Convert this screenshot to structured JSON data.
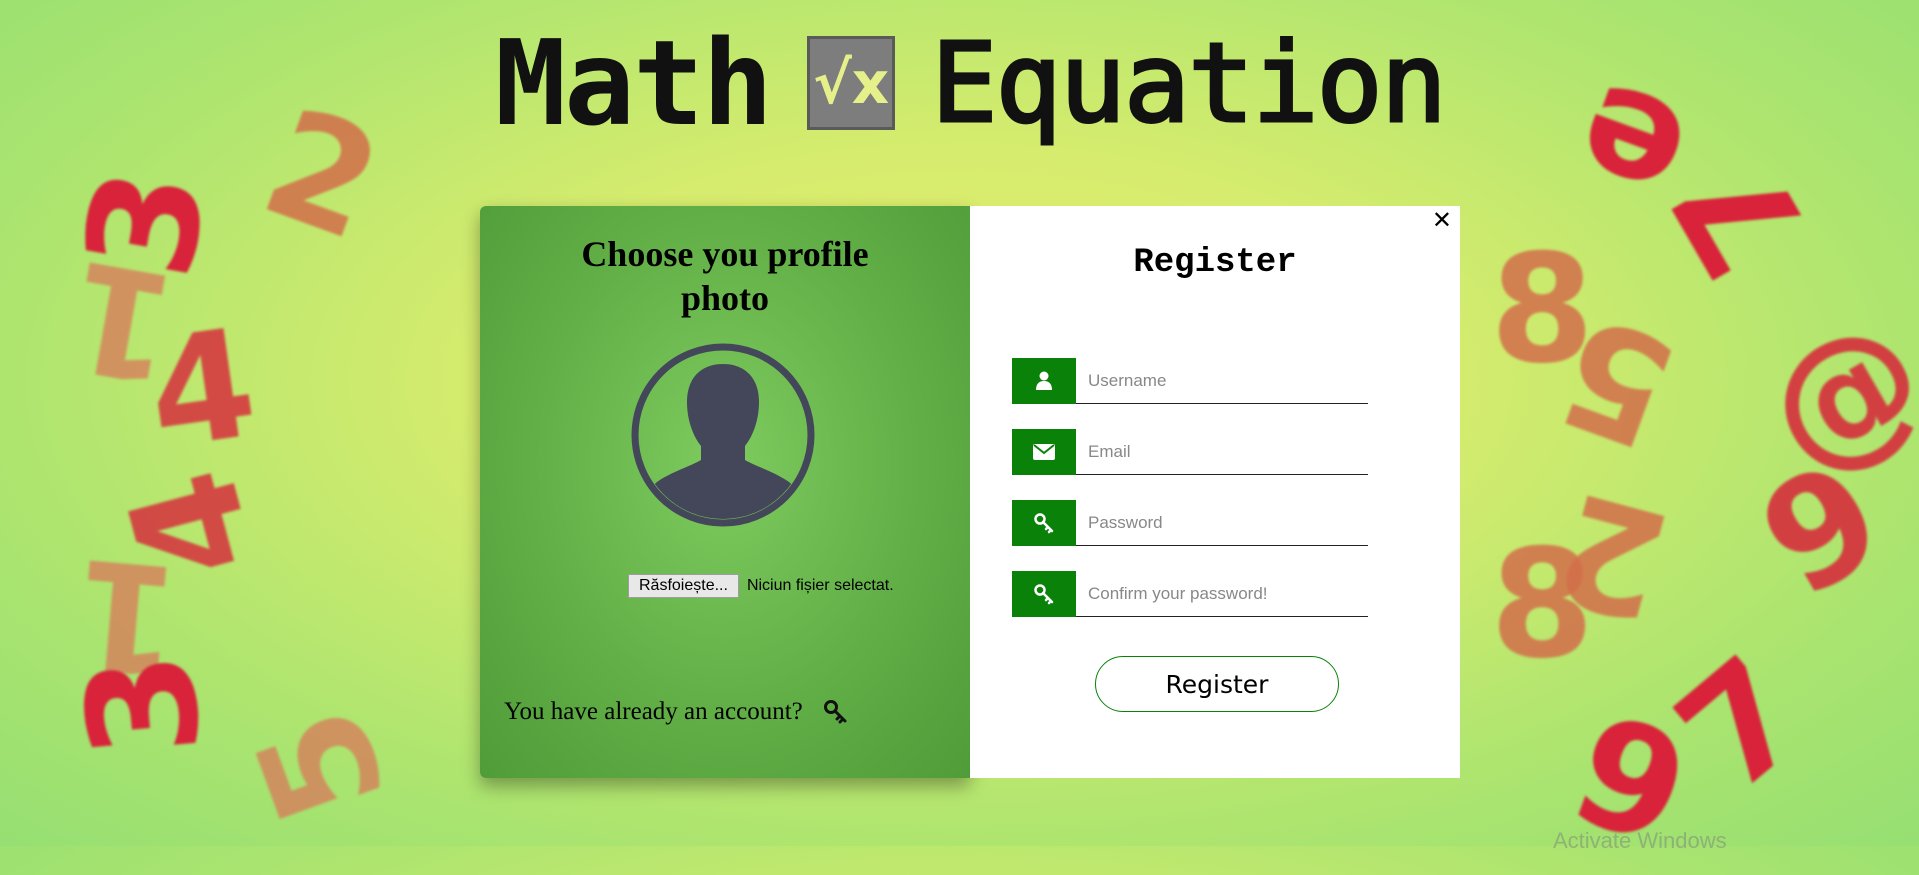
{
  "title": {
    "word1": "Math",
    "logo": "√x",
    "word2": "Equation"
  },
  "deco_digits": {
    "left": [
      "3",
      "2",
      "1",
      "4",
      "4",
      "1",
      "3",
      "5"
    ],
    "right": [
      "e",
      "7",
      "8",
      "5",
      "@",
      "9",
      "2",
      "8",
      "7",
      "6"
    ]
  },
  "photo_panel": {
    "heading": "Choose you profile photo",
    "browse_button": "Răsfoiește...",
    "no_file_text": "Niciun fișier selectat.",
    "already_account": "You have already an account?"
  },
  "register_panel": {
    "heading": "Register",
    "close": "✕",
    "fields": [
      {
        "placeholder": "Username",
        "icon": "user-icon"
      },
      {
        "placeholder": "Email",
        "icon": "envelope-icon"
      },
      {
        "placeholder": "Password",
        "icon": "key-icon"
      },
      {
        "placeholder": "Confirm your password!",
        "icon": "key-icon"
      }
    ],
    "submit": "Register"
  },
  "colors": {
    "accent": "#0a820a",
    "panel_green": "#62af47",
    "digit_red": "#d8233a"
  },
  "watermark": "Activate Windows"
}
